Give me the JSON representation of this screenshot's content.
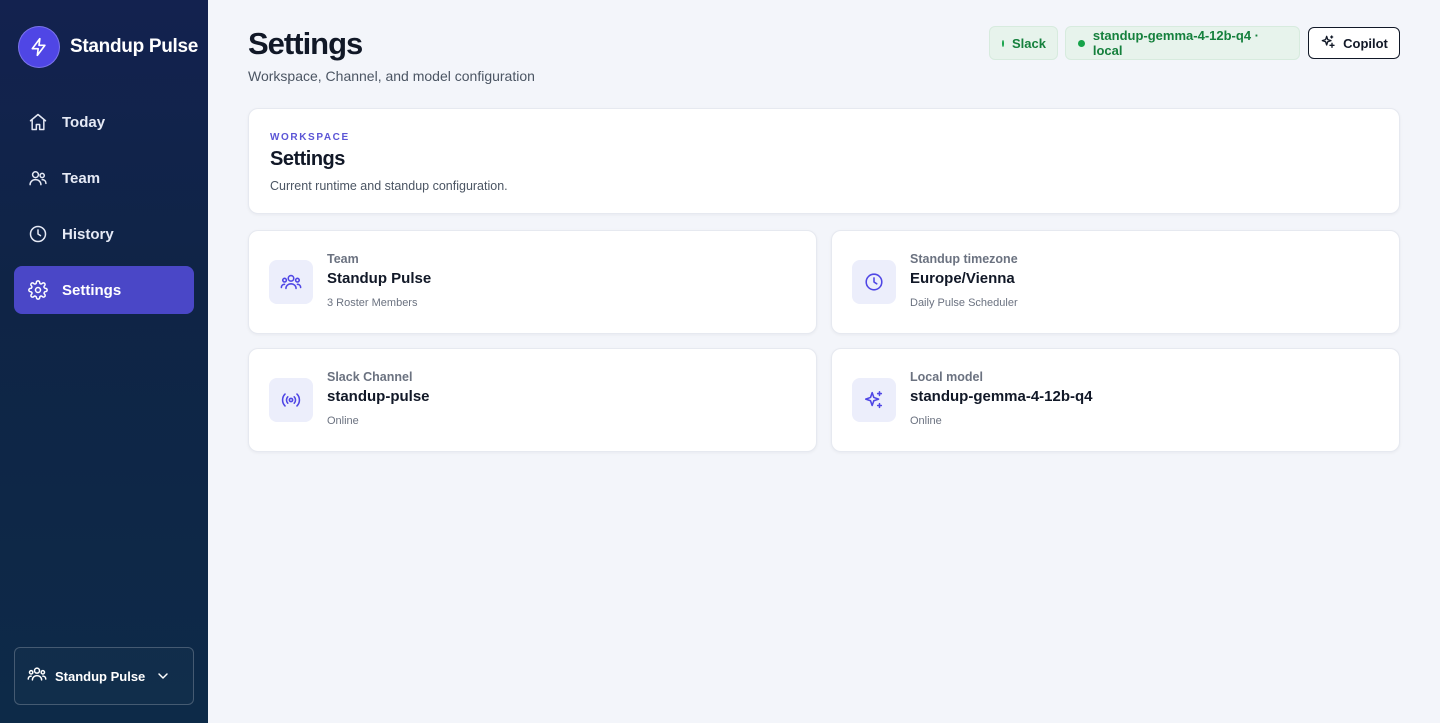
{
  "app": {
    "name": "Standup Pulse"
  },
  "sidebar": {
    "items": [
      {
        "label": "Today",
        "icon": "home-icon"
      },
      {
        "label": "Team",
        "icon": "users-icon"
      },
      {
        "label": "History",
        "icon": "clock-icon"
      },
      {
        "label": "Settings",
        "icon": "gear-icon",
        "active": true
      }
    ],
    "team_switcher": {
      "label": "Standup Pulse",
      "icon": "team-icon"
    }
  },
  "header": {
    "title": "Settings",
    "subtitle": "Workspace, Channel, and model configuration",
    "status_pills": [
      {
        "label": "Slack",
        "color": "#16a34a"
      },
      {
        "label": "standup-gemma-4-12b-q4 · local",
        "color": "#16a34a"
      }
    ],
    "copilot_label": "Copilot"
  },
  "workspace_card": {
    "eyebrow": "WORKSPACE",
    "title": "Settings",
    "description": "Current runtime and standup configuration."
  },
  "info_cards": [
    {
      "label": "Team",
      "value": "Standup Pulse",
      "sub": "3 Roster Members",
      "icon": "team-icon"
    },
    {
      "label": "Standup timezone",
      "value": "Europe/Vienna",
      "sub": "Daily Pulse Scheduler",
      "icon": "clock-icon"
    },
    {
      "label": "Slack Channel",
      "value": "standup-pulse",
      "sub": "Online",
      "icon": "broadcast-icon"
    },
    {
      "label": "Local model",
      "value": "standup-gemma-4-12b-q4",
      "sub": "Online",
      "icon": "sparkles-icon"
    }
  ],
  "colors": {
    "accent": "#4a47c7",
    "success": "#16a34a",
    "sidebar": "#0f2446"
  }
}
